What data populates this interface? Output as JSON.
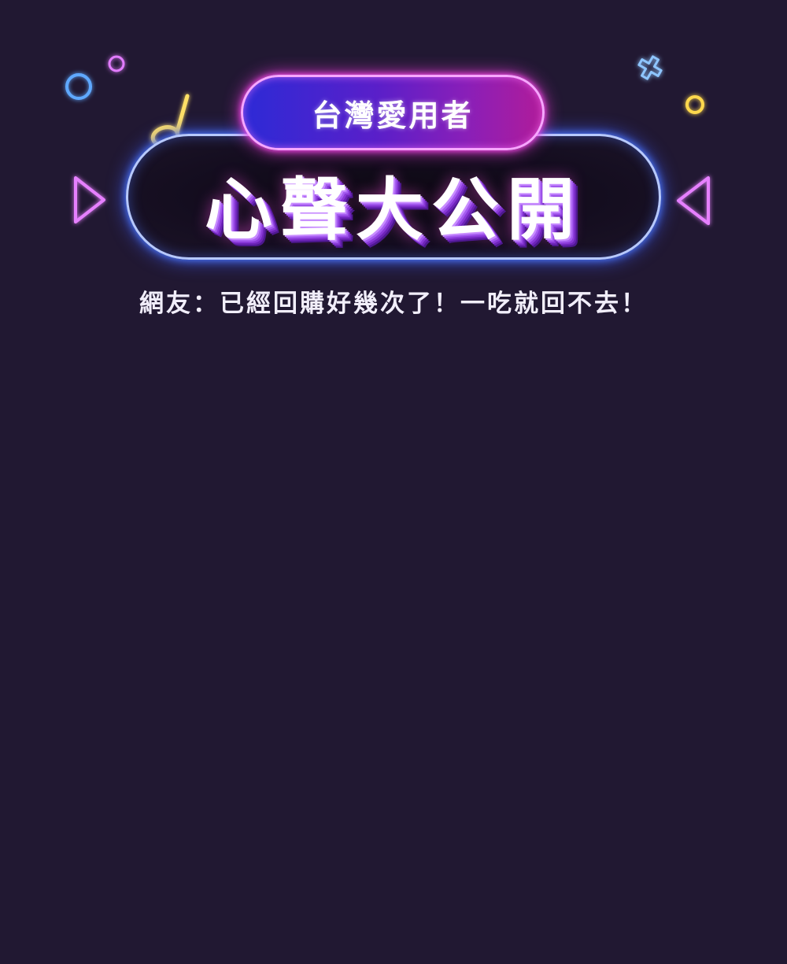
{
  "banner": {
    "tag_label": "台灣愛用者",
    "headline": "心聲大公開",
    "subtitle": "網友：已經回購好幾次了！一吃就回不去！"
  },
  "decorations": {
    "icons": [
      "ring-icon",
      "music-note-icon",
      "cross-icon",
      "play-arrow-icon"
    ]
  },
  "colors": {
    "background": "#211832",
    "neon_blue": "#4f7dff",
    "neon_pink": "#ff4df2",
    "neon_yellow": "#ffe066"
  }
}
